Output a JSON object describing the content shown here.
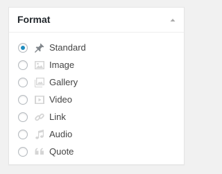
{
  "panel": {
    "title": "Format",
    "toggle_icon": "triangle-up-icon"
  },
  "formats": [
    {
      "label": "Standard",
      "icon": "pin-icon",
      "selected": true
    },
    {
      "label": "Image",
      "icon": "image-icon",
      "selected": false
    },
    {
      "label": "Gallery",
      "icon": "gallery-icon",
      "selected": false
    },
    {
      "label": "Video",
      "icon": "video-icon",
      "selected": false
    },
    {
      "label": "Link",
      "icon": "link-icon",
      "selected": false
    },
    {
      "label": "Audio",
      "icon": "music-note-icon",
      "selected": false
    },
    {
      "label": "Quote",
      "icon": "quote-icon",
      "selected": false
    }
  ],
  "colors": {
    "radio_checked": "#1e8cbe",
    "icon_active": "#82878c",
    "icon_inactive": "#cccccc"
  }
}
